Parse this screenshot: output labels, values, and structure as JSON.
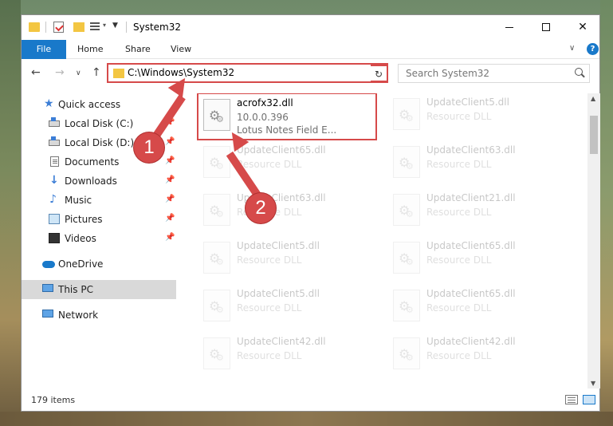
{
  "window": {
    "title": "System32",
    "controls": {
      "minimize": "",
      "maximize": "",
      "close": "✕"
    }
  },
  "ribbon": {
    "tabs": [
      "File",
      "Home",
      "Share",
      "View"
    ],
    "help": "?"
  },
  "navigation": {
    "address": "C:\\Windows\\System32",
    "search_placeholder": "Search System32"
  },
  "sidebar": {
    "items": [
      {
        "label": "Quick access",
        "icon": "star-icon",
        "pinned": false
      },
      {
        "label": "Local Disk (C:)",
        "icon": "disk-icon",
        "pinned": true
      },
      {
        "label": "Local Disk (D:)",
        "icon": "disk-icon",
        "pinned": true
      },
      {
        "label": "Documents",
        "icon": "document-icon",
        "pinned": true
      },
      {
        "label": "Downloads",
        "icon": "download-icon",
        "pinned": true
      },
      {
        "label": "Music",
        "icon": "music-icon",
        "pinned": true
      },
      {
        "label": "Pictures",
        "icon": "pictures-icon",
        "pinned": true
      },
      {
        "label": "Videos",
        "icon": "videos-icon",
        "pinned": true
      },
      {
        "label": "OneDrive",
        "icon": "cloud-icon",
        "pinned": false
      },
      {
        "label": "This PC",
        "icon": "computer-icon",
        "pinned": false,
        "selected": true
      },
      {
        "label": "Network",
        "icon": "network-icon",
        "pinned": false
      }
    ]
  },
  "files": {
    "highlighted": {
      "name": "acrofx32.dll",
      "line2": "10.0.0.396",
      "line3": "Lotus Notes Field E..."
    },
    "left_column": [
      {
        "name": "UpdateClient65.dll",
        "type": "Resource DLL"
      },
      {
        "name": "UpdateClient63.dll",
        "type": "Resource DLL"
      },
      {
        "name": "UpdateClient5.dll",
        "type": "Resource DLL"
      },
      {
        "name": "UpdateClient5.dll",
        "type": "Resource DLL"
      },
      {
        "name": "UpdateClient42.dll",
        "type": "Resource DLL"
      }
    ],
    "right_column": [
      {
        "name": "UpdateClient5.dll",
        "type": "Resource DLL"
      },
      {
        "name": "UpdateClient63.dll",
        "type": "Resource DLL"
      },
      {
        "name": "UpdateClient21.dll",
        "type": "Resource DLL"
      },
      {
        "name": "UpdateClient65.dll",
        "type": "Resource DLL"
      },
      {
        "name": "UpdateClient65.dll",
        "type": "Resource DLL"
      },
      {
        "name": "UpdateClient42.dll",
        "type": "Resource DLL"
      }
    ]
  },
  "status": {
    "item_count": "179 items"
  },
  "annotations": {
    "step1": "1",
    "step2": "2",
    "color": "#d64a4a"
  }
}
